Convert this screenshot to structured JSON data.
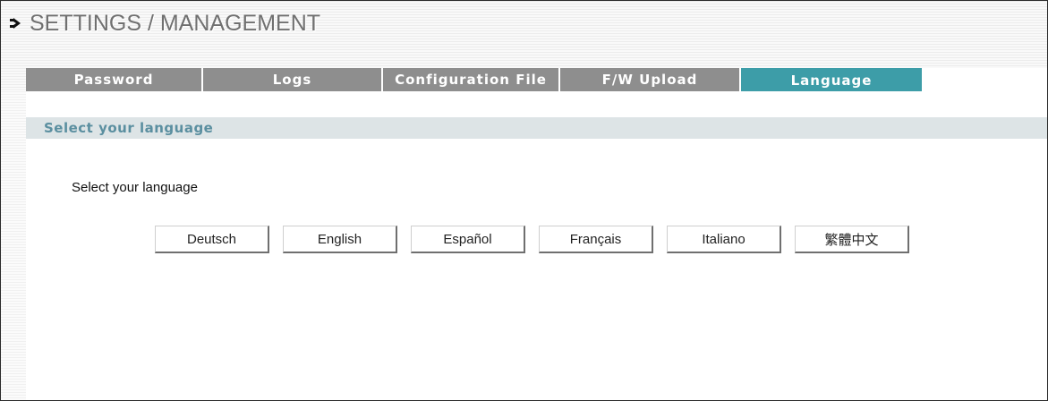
{
  "header": {
    "title": "SETTINGS / MANAGEMENT"
  },
  "tabs": [
    {
      "label": "Password"
    },
    {
      "label": "Logs"
    },
    {
      "label": "Configuration File"
    },
    {
      "label": "F/W Upload"
    },
    {
      "label": "Language"
    }
  ],
  "section": {
    "title": "Select your language",
    "prompt": "Select your language"
  },
  "languages": [
    {
      "label": "Deutsch"
    },
    {
      "label": "English"
    },
    {
      "label": "Español"
    },
    {
      "label": "Français"
    },
    {
      "label": "Italiano"
    },
    {
      "label": "繁體中文"
    }
  ],
  "colors": {
    "tab_inactive": "#8e8e8e",
    "tab_active": "#3d9da8",
    "section_bar": "#dde4e6",
    "section_title": "#5b8fa0"
  },
  "icons": {
    "title_bullet": "arrow-bullet-icon"
  }
}
